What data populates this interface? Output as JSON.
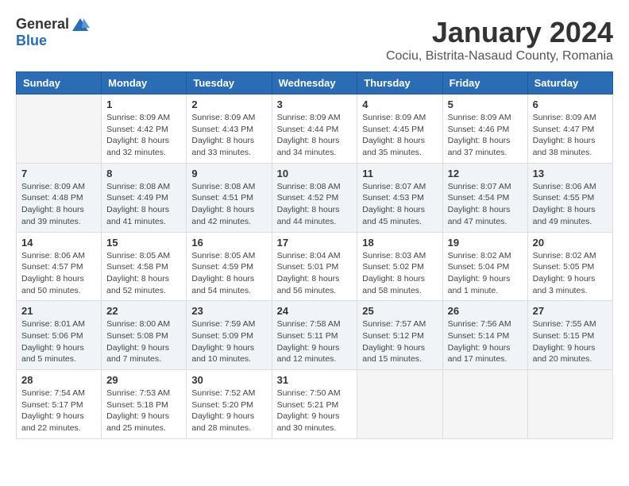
{
  "logo": {
    "general": "General",
    "blue": "Blue"
  },
  "title": {
    "month": "January 2024",
    "location": "Cociu, Bistrita-Nasaud County, Romania"
  },
  "weekdays": [
    "Sunday",
    "Monday",
    "Tuesday",
    "Wednesday",
    "Thursday",
    "Friday",
    "Saturday"
  ],
  "weeks": [
    [
      {
        "day": "",
        "empty": true
      },
      {
        "day": "1",
        "sunrise": "Sunrise: 8:09 AM",
        "sunset": "Sunset: 4:42 PM",
        "daylight": "Daylight: 8 hours and 32 minutes."
      },
      {
        "day": "2",
        "sunrise": "Sunrise: 8:09 AM",
        "sunset": "Sunset: 4:43 PM",
        "daylight": "Daylight: 8 hours and 33 minutes."
      },
      {
        "day": "3",
        "sunrise": "Sunrise: 8:09 AM",
        "sunset": "Sunset: 4:44 PM",
        "daylight": "Daylight: 8 hours and 34 minutes."
      },
      {
        "day": "4",
        "sunrise": "Sunrise: 8:09 AM",
        "sunset": "Sunset: 4:45 PM",
        "daylight": "Daylight: 8 hours and 35 minutes."
      },
      {
        "day": "5",
        "sunrise": "Sunrise: 8:09 AM",
        "sunset": "Sunset: 4:46 PM",
        "daylight": "Daylight: 8 hours and 37 minutes."
      },
      {
        "day": "6",
        "sunrise": "Sunrise: 8:09 AM",
        "sunset": "Sunset: 4:47 PM",
        "daylight": "Daylight: 8 hours and 38 minutes."
      }
    ],
    [
      {
        "day": "7",
        "sunrise": "Sunrise: 8:09 AM",
        "sunset": "Sunset: 4:48 PM",
        "daylight": "Daylight: 8 hours and 39 minutes."
      },
      {
        "day": "8",
        "sunrise": "Sunrise: 8:08 AM",
        "sunset": "Sunset: 4:49 PM",
        "daylight": "Daylight: 8 hours and 41 minutes."
      },
      {
        "day": "9",
        "sunrise": "Sunrise: 8:08 AM",
        "sunset": "Sunset: 4:51 PM",
        "daylight": "Daylight: 8 hours and 42 minutes."
      },
      {
        "day": "10",
        "sunrise": "Sunrise: 8:08 AM",
        "sunset": "Sunset: 4:52 PM",
        "daylight": "Daylight: 8 hours and 44 minutes."
      },
      {
        "day": "11",
        "sunrise": "Sunrise: 8:07 AM",
        "sunset": "Sunset: 4:53 PM",
        "daylight": "Daylight: 8 hours and 45 minutes."
      },
      {
        "day": "12",
        "sunrise": "Sunrise: 8:07 AM",
        "sunset": "Sunset: 4:54 PM",
        "daylight": "Daylight: 8 hours and 47 minutes."
      },
      {
        "day": "13",
        "sunrise": "Sunrise: 8:06 AM",
        "sunset": "Sunset: 4:55 PM",
        "daylight": "Daylight: 8 hours and 49 minutes."
      }
    ],
    [
      {
        "day": "14",
        "sunrise": "Sunrise: 8:06 AM",
        "sunset": "Sunset: 4:57 PM",
        "daylight": "Daylight: 8 hours and 50 minutes."
      },
      {
        "day": "15",
        "sunrise": "Sunrise: 8:05 AM",
        "sunset": "Sunset: 4:58 PM",
        "daylight": "Daylight: 8 hours and 52 minutes."
      },
      {
        "day": "16",
        "sunrise": "Sunrise: 8:05 AM",
        "sunset": "Sunset: 4:59 PM",
        "daylight": "Daylight: 8 hours and 54 minutes."
      },
      {
        "day": "17",
        "sunrise": "Sunrise: 8:04 AM",
        "sunset": "Sunset: 5:01 PM",
        "daylight": "Daylight: 8 hours and 56 minutes."
      },
      {
        "day": "18",
        "sunrise": "Sunrise: 8:03 AM",
        "sunset": "Sunset: 5:02 PM",
        "daylight": "Daylight: 8 hours and 58 minutes."
      },
      {
        "day": "19",
        "sunrise": "Sunrise: 8:02 AM",
        "sunset": "Sunset: 5:04 PM",
        "daylight": "Daylight: 9 hours and 1 minute."
      },
      {
        "day": "20",
        "sunrise": "Sunrise: 8:02 AM",
        "sunset": "Sunset: 5:05 PM",
        "daylight": "Daylight: 9 hours and 3 minutes."
      }
    ],
    [
      {
        "day": "21",
        "sunrise": "Sunrise: 8:01 AM",
        "sunset": "Sunset: 5:06 PM",
        "daylight": "Daylight: 9 hours and 5 minutes."
      },
      {
        "day": "22",
        "sunrise": "Sunrise: 8:00 AM",
        "sunset": "Sunset: 5:08 PM",
        "daylight": "Daylight: 9 hours and 7 minutes."
      },
      {
        "day": "23",
        "sunrise": "Sunrise: 7:59 AM",
        "sunset": "Sunset: 5:09 PM",
        "daylight": "Daylight: 9 hours and 10 minutes."
      },
      {
        "day": "24",
        "sunrise": "Sunrise: 7:58 AM",
        "sunset": "Sunset: 5:11 PM",
        "daylight": "Daylight: 9 hours and 12 minutes."
      },
      {
        "day": "25",
        "sunrise": "Sunrise: 7:57 AM",
        "sunset": "Sunset: 5:12 PM",
        "daylight": "Daylight: 9 hours and 15 minutes."
      },
      {
        "day": "26",
        "sunrise": "Sunrise: 7:56 AM",
        "sunset": "Sunset: 5:14 PM",
        "daylight": "Daylight: 9 hours and 17 minutes."
      },
      {
        "day": "27",
        "sunrise": "Sunrise: 7:55 AM",
        "sunset": "Sunset: 5:15 PM",
        "daylight": "Daylight: 9 hours and 20 minutes."
      }
    ],
    [
      {
        "day": "28",
        "sunrise": "Sunrise: 7:54 AM",
        "sunset": "Sunset: 5:17 PM",
        "daylight": "Daylight: 9 hours and 22 minutes."
      },
      {
        "day": "29",
        "sunrise": "Sunrise: 7:53 AM",
        "sunset": "Sunset: 5:18 PM",
        "daylight": "Daylight: 9 hours and 25 minutes."
      },
      {
        "day": "30",
        "sunrise": "Sunrise: 7:52 AM",
        "sunset": "Sunset: 5:20 PM",
        "daylight": "Daylight: 9 hours and 28 minutes."
      },
      {
        "day": "31",
        "sunrise": "Sunrise: 7:50 AM",
        "sunset": "Sunset: 5:21 PM",
        "daylight": "Daylight: 9 hours and 30 minutes."
      },
      {
        "day": "",
        "empty": true
      },
      {
        "day": "",
        "empty": true
      },
      {
        "day": "",
        "empty": true
      }
    ]
  ]
}
